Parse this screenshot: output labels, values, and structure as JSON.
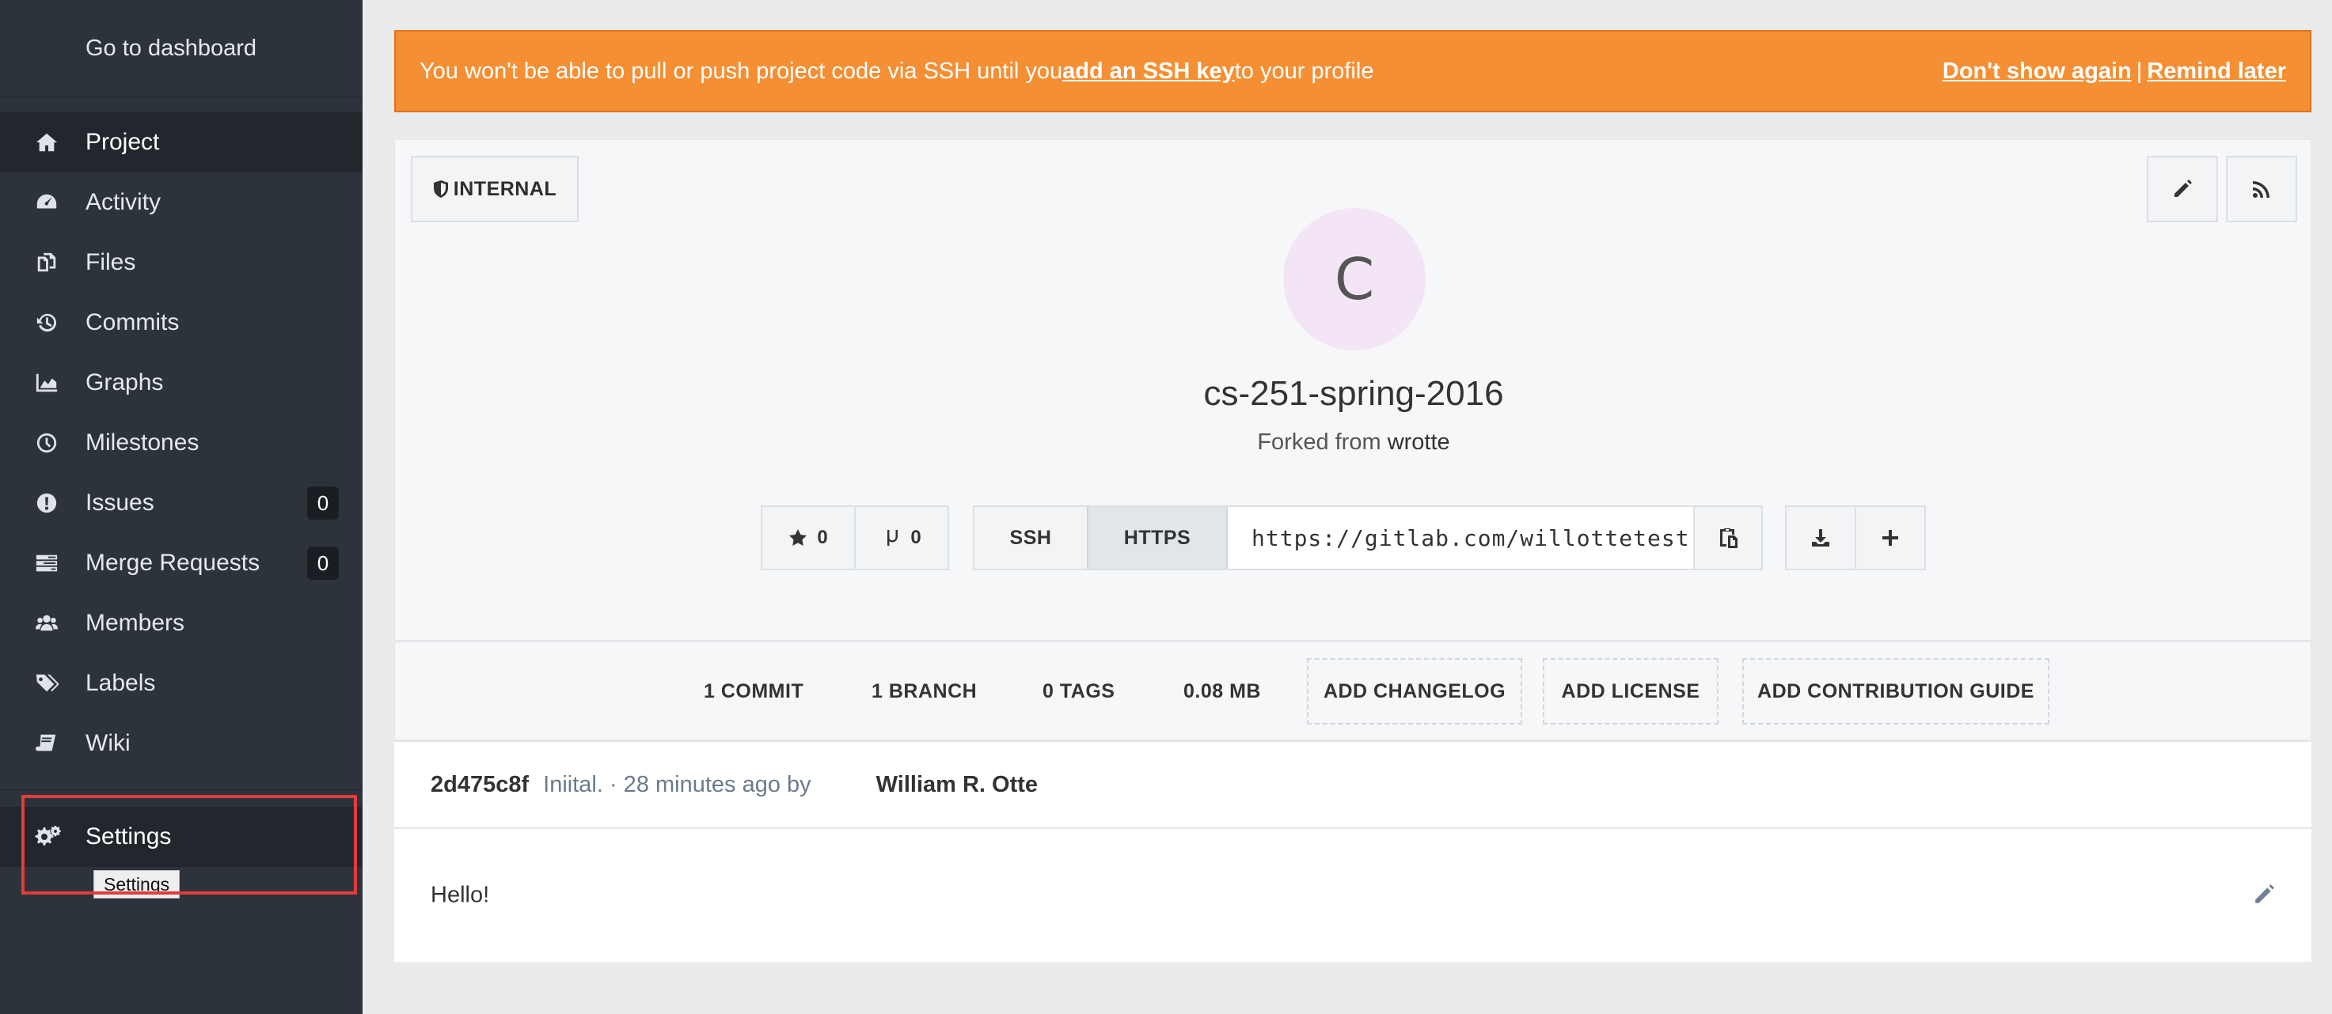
{
  "sidebar": {
    "dashboard_label": "Go to dashboard",
    "items": [
      {
        "label": "Project",
        "icon": "home-icon"
      },
      {
        "label": "Activity",
        "icon": "dashboard-icon"
      },
      {
        "label": "Files",
        "icon": "files-icon"
      },
      {
        "label": "Commits",
        "icon": "history-icon"
      },
      {
        "label": "Graphs",
        "icon": "area-chart-icon"
      },
      {
        "label": "Milestones",
        "icon": "clock-icon"
      },
      {
        "label": "Issues",
        "icon": "exclamation-circle-icon",
        "count": "0"
      },
      {
        "label": "Merge Requests",
        "icon": "tasks-icon",
        "count": "0"
      },
      {
        "label": "Members",
        "icon": "users-icon"
      },
      {
        "label": "Labels",
        "icon": "tags-icon"
      },
      {
        "label": "Wiki",
        "icon": "book-icon"
      }
    ],
    "settings_label": "Settings",
    "settings_tooltip": "Settings"
  },
  "banner": {
    "text_before": "You won't be able to pull or push project code via SSH until you ",
    "link": "add an SSH key",
    "text_after": " to your profile",
    "dont_show": "Don't show again",
    "separator": "|",
    "remind": "Remind later",
    "color": "#f58f34"
  },
  "project": {
    "visibility": "INTERNAL",
    "avatar_letter": "C",
    "title": "cs-251-spring-2016",
    "forked_prefix": "Forked from",
    "forked_from": "wrotte",
    "stars": "0",
    "forks": "0",
    "clone_ssh": "SSH",
    "clone_https": "HTTPS",
    "clone_url": "https://gitlab.com/willottetest"
  },
  "stats": {
    "commits": "1 COMMIT",
    "branches": "1 BRANCH",
    "tags": "0 TAGS",
    "size": "0.08 MB",
    "add_changelog": "ADD CHANGELOG",
    "add_license": "ADD LICENSE",
    "add_contribution": "ADD CONTRIBUTION GUIDE"
  },
  "commit": {
    "sha": "2d475c8f",
    "message": "Iniital. · 28 minutes ago by",
    "author": "William R. Otte"
  },
  "readme": {
    "text": "Hello!"
  }
}
